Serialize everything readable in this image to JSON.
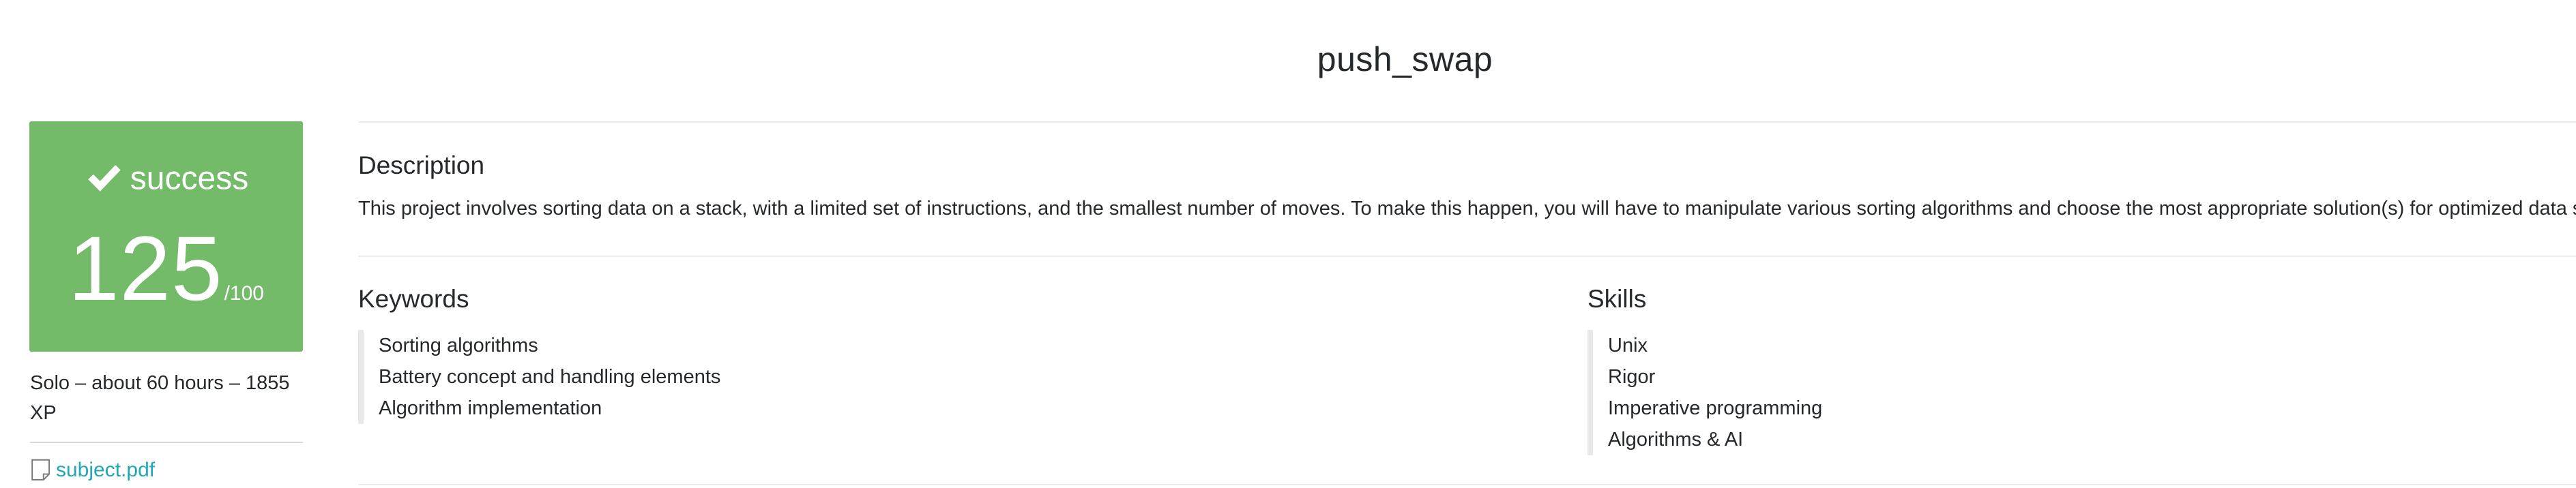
{
  "project": {
    "title": "push_swap"
  },
  "result": {
    "status": "success",
    "score": "125",
    "max_score": "/100",
    "status_color": "#73ba69"
  },
  "meta": {
    "summary": "Solo – about 60 hours – 1855 XP"
  },
  "attachment": {
    "icon": "file-icon",
    "label": "subject.pdf",
    "link_color": "#20a8b8"
  },
  "description": {
    "heading": "Description",
    "text": "This project involves sorting data on a stack, with a limited set of instructions, and the smallest number of moves. To make this happen, you will have to manipulate various sorting algorithms and choose the most appropriate solution(s) for optimized data sorting."
  },
  "keywords": {
    "heading": "Keywords",
    "items": [
      "Sorting algorithms",
      "Battery concept and handling elements",
      "Algorithm implementation"
    ]
  },
  "skills": {
    "heading": "Skills",
    "items": [
      "Unix",
      "Rigor",
      "Imperative programming",
      "Algorithms & AI"
    ]
  }
}
